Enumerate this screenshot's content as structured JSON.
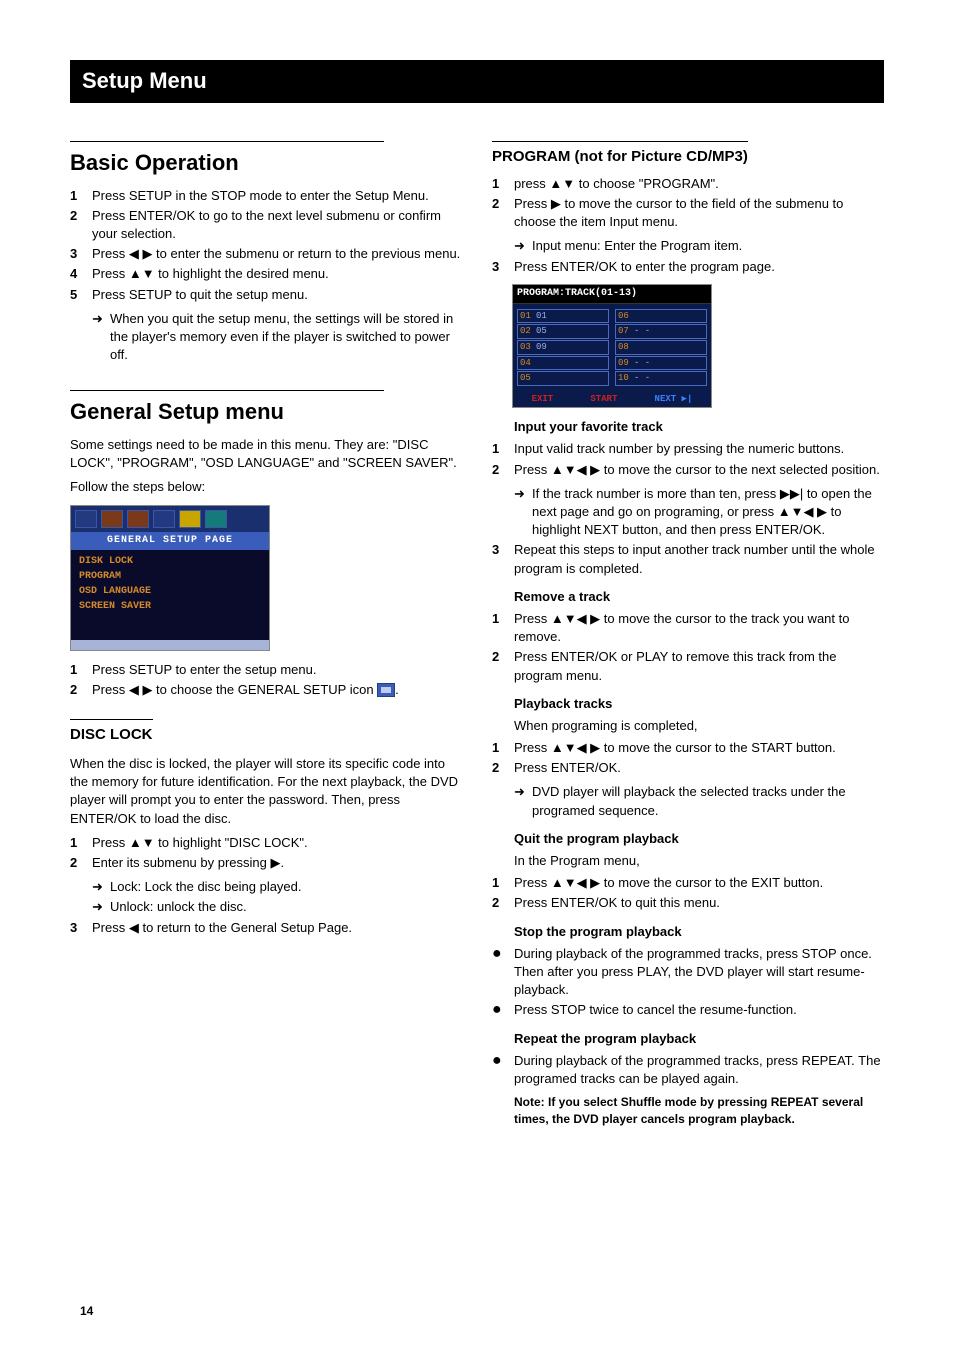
{
  "header": "Setup Menu",
  "pageNumber": "14",
  "glyphs": {
    "up": "▲",
    "down": "▼",
    "left": "◀",
    "right": "▶",
    "updown": "▲▼",
    "leftright": "◀ ▶",
    "all4": "▲▼◀ ▶",
    "nextpage": "▶▶|",
    "arrow": "➜",
    "bullet": "●"
  },
  "left": {
    "basic": {
      "title": "Basic Operation",
      "items": [
        "Press SETUP in the STOP mode to enter the Setup Menu.",
        "Press ENTER/OK to go to the next level submenu or confirm your selection.",
        "Press ◀ ▶ to enter the submenu or return to the previous menu.",
        "Press ▲▼ to highlight the desired menu.",
        "Press SETUP to quit the setup menu."
      ],
      "note": "When you quit the setup menu, the settings will be stored in the player's memory even if the player is switched to power off."
    },
    "general": {
      "title": "General Setup menu",
      "intro1": "Some settings need to be made in this menu. They are: \"DISC LOCK\", \"PROGRAM\", \"OSD LANGUAGE\" and \"SCREEN SAVER\".",
      "intro2": "Follow the steps below:",
      "osd": {
        "title": "GENERAL SETUP PAGE",
        "items": [
          "DISK LOCK",
          "PROGRAM",
          "OSD LANGUAGE",
          "SCREEN SAVER"
        ]
      },
      "steps": [
        "Press SETUP to enter the setup menu.",
        "Press ◀ ▶ to choose the GENERAL SETUP icon "
      ],
      "stepsTail": "."
    },
    "disclock": {
      "title": "DISC LOCK",
      "intro": "When the disc is locked, the player will store its specific code into the memory for future identification. For the next playback, the DVD player will prompt you to enter the password. Then, press ENTER/OK to load the disc.",
      "s1": "Press ▲▼ to highlight \"DISC LOCK\".",
      "s2": "Enter its submenu by pressing ▶.",
      "s2a": "Lock: Lock the disc being played.",
      "s2b": "Unlock: unlock the disc.",
      "s3": "Press ◀ to return to the General Setup Page."
    }
  },
  "right": {
    "program": {
      "title": "PROGRAM (not for Picture CD/MP3)",
      "s1": "press ▲▼ to choose \"PROGRAM\".",
      "s2": "Press ▶ to move the cursor to the field of the submenu to choose the item Input menu.",
      "s2a": "Input menu: Enter the Program item.",
      "s3": "Press ENTER/OK to enter the program page.",
      "osd": {
        "header": "PROGRAM:TRACK(01-13)",
        "leftRows": [
          {
            "n": "01",
            "v": "01"
          },
          {
            "n": "02",
            "v": "05"
          },
          {
            "n": "03",
            "v": "09"
          },
          {
            "n": "04",
            "v": ""
          },
          {
            "n": "05",
            "v": ""
          }
        ],
        "rightRows": [
          {
            "n": "06",
            "v": ""
          },
          {
            "n": "07",
            "v": "- -"
          },
          {
            "n": "08",
            "v": ""
          },
          {
            "n": "09",
            "v": "- -"
          },
          {
            "n": "10",
            "v": "- -"
          }
        ],
        "foot": {
          "exit": "EXIT",
          "start": "START",
          "next": "NEXT ▶|"
        }
      }
    },
    "inputFav": {
      "title": "Input your favorite track",
      "s1": "Input valid track number by pressing the numeric buttons.",
      "s2": "Press ▲▼◀ ▶ to move the cursor to the next selected position.",
      "s2a": "If the track number is more than ten, press ▶▶| to open the next page and go on programing, or press ▲▼◀ ▶ to highlight NEXT button, and then press ENTER/OK.",
      "s3": "Repeat this steps to input another track number until the whole program is completed."
    },
    "remove": {
      "title": "Remove a track",
      "s1": "Press ▲▼◀ ▶ to move the cursor to the track you want to remove.",
      "s2": "Press ENTER/OK or PLAY to remove this track from the program menu."
    },
    "playback": {
      "title": "Playback tracks",
      "intro": "When programing is completed,",
      "s1": "Press ▲▼◀ ▶ to move the cursor to the START button.",
      "s2": "Press ENTER/OK.",
      "s2a": "DVD player will playback the selected tracks under the programed sequence."
    },
    "quit": {
      "title": "Quit the program playback",
      "intro": "In the Program menu,",
      "s1": "Press ▲▼◀ ▶ to move the cursor to the EXIT button.",
      "s2": "Press ENTER/OK to quit this menu."
    },
    "stop": {
      "title": "Stop the program playback",
      "b1": "During playback of the programmed tracks, press STOP once. Then after you press PLAY, the DVD player will start resume-playback.",
      "b2": "Press STOP twice to cancel the resume-function."
    },
    "repeat": {
      "title": "Repeat the program playback",
      "b1": "During playback of the programmed tracks, press REPEAT. The programed tracks can be played again.",
      "note": "Note: If you select Shuffle mode by pressing REPEAT several times, the DVD player cancels program playback."
    }
  }
}
